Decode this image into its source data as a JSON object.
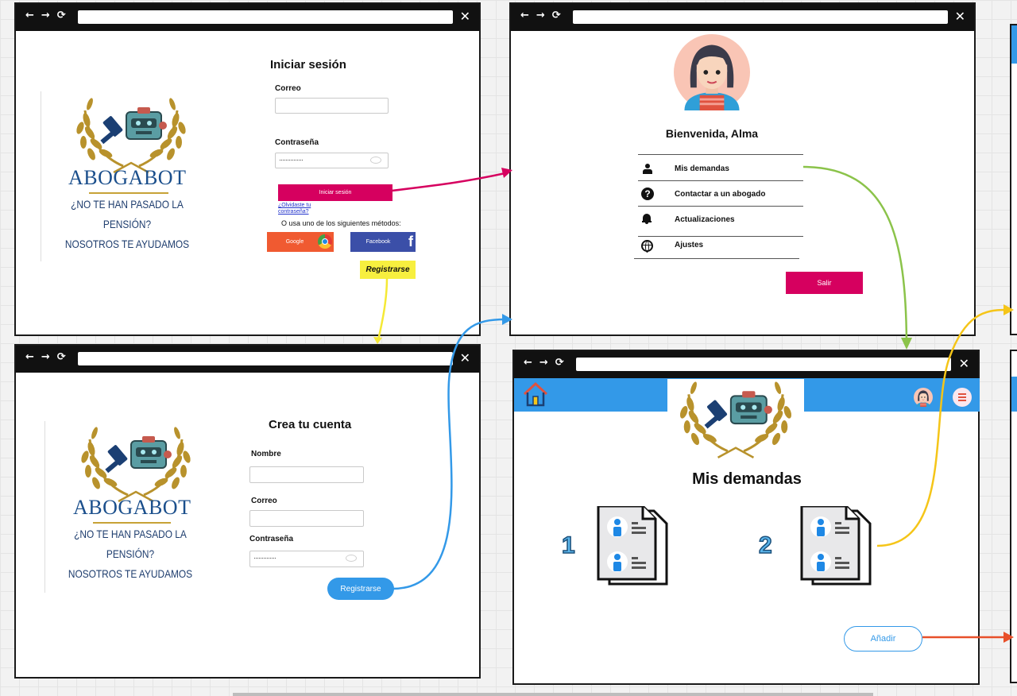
{
  "login": {
    "title": "Iniciar sesión",
    "email_label": "Correo",
    "password_label": "Contraseña",
    "password_value": "···············",
    "submit_label": "Iniciar sesión",
    "forgot_line1": "¿Olvidaste tu",
    "forgot_line2": "contraseña?",
    "methods_text": "O usa uno de los siguientes métodos:",
    "google_label": "Google",
    "facebook_label": "Facebook",
    "register_note": "Registrarse"
  },
  "brand": {
    "name": "ABOGABOT",
    "tagline_1": "¿NO TE HAN PASADO LA",
    "tagline_2": "PENSIÓN?",
    "tagline_3": "NOSOTROS TE AYUDAMOS"
  },
  "profile": {
    "welcome": "Bienvenida, Alma",
    "menu": [
      {
        "label": "Mis demandas",
        "icon": "person-icon"
      },
      {
        "label": "Contactar a un abogado",
        "icon": "question-circle-icon"
      },
      {
        "label": "Actualizaciones",
        "icon": "bell-icon"
      },
      {
        "label": "Ajustes",
        "icon": "globe-icon"
      }
    ],
    "logout_label": "Salir"
  },
  "signup": {
    "title": "Crea tu cuenta",
    "name_label": "Nombre",
    "email_label": "Correo",
    "password_label": "Contraseña",
    "password_value": "··············",
    "submit_label": "Registrarse"
  },
  "demandas": {
    "title": "Mis demandas",
    "items": [
      {
        "number": "1"
      },
      {
        "number": "2"
      }
    ],
    "add_label": "Añadir"
  },
  "colors": {
    "primary_pink": "#d6005f",
    "blue": "#3399e8",
    "google_red": "#f05a31",
    "facebook_blue": "#3b4fa8",
    "note_yellow": "#f7ef3f",
    "arrow_green": "#8bc34a",
    "arrow_yellow": "#f5c518",
    "arrow_orange": "#e8502a"
  }
}
